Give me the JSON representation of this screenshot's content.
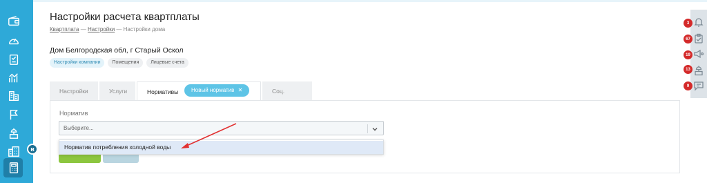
{
  "page": {
    "title": "Настройки расчета квартплаты",
    "breadcrumb": {
      "item1": "Квартплата",
      "sep1": " — ",
      "item2": "Настройки",
      "sep2": " — ",
      "current": "Настройки дома"
    },
    "house_name": "Дом Белгородская обл, г Старый Оскол",
    "chips": [
      "Настройки компании",
      "Помещения",
      "Лицевые счета"
    ]
  },
  "tabs": {
    "items": [
      "Настройки",
      "Услуги",
      "Нормативы",
      "Соц. нормы"
    ],
    "selected": "Нормативы",
    "new_pill": "Новый норматив",
    "new_pill_close": "✕"
  },
  "form": {
    "field_label": "Норматив",
    "select_placeholder": "Выберите...",
    "dropdown_option": "Норматив потребления холодной воды"
  },
  "sidebar": {
    "badge": "в",
    "icons": [
      "wallet-icon",
      "gauge-icon",
      "checklist-icon",
      "chart-icon",
      "buildings-icon",
      "flag-icon",
      "worker-icon",
      "city-icon",
      "calculator-icon"
    ]
  },
  "right_rail": {
    "badges": [
      "3",
      "67",
      "19",
      "13",
      "9"
    ],
    "icons": [
      "bell-icon",
      "clipboard-icon",
      "megaphone-icon",
      "worker-icon",
      "chat-icon"
    ]
  },
  "colors": {
    "sidebar": "#2ea9d8",
    "accent_pill": "#5ec4e6",
    "badge_red": "#d42a2a",
    "green_button": "#8cc63f",
    "arrow": "#e23232"
  }
}
